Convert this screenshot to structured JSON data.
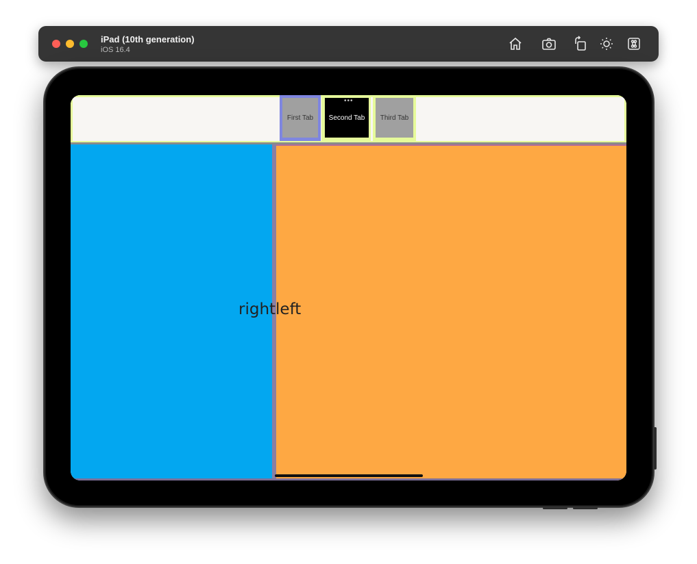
{
  "window": {
    "device_name": "iPad (10th generation)",
    "os_version": "iOS 16.4",
    "toolbar_icons": [
      "home-icon",
      "screenshot-icon",
      "rotate-icon",
      "appearance-icon",
      "keyboard-command-icon"
    ]
  },
  "app": {
    "tabs": [
      {
        "label": "First Tab"
      },
      {
        "label": "Second Tab",
        "selected": true
      },
      {
        "label": "Third Tab"
      }
    ],
    "center_text": "rightleft"
  },
  "colors": {
    "left_pane": "#03a7f0",
    "right_pane": "#fea843",
    "tab_bar_border": "#e6fa9a",
    "first_tab_border": "#7f86e0"
  }
}
